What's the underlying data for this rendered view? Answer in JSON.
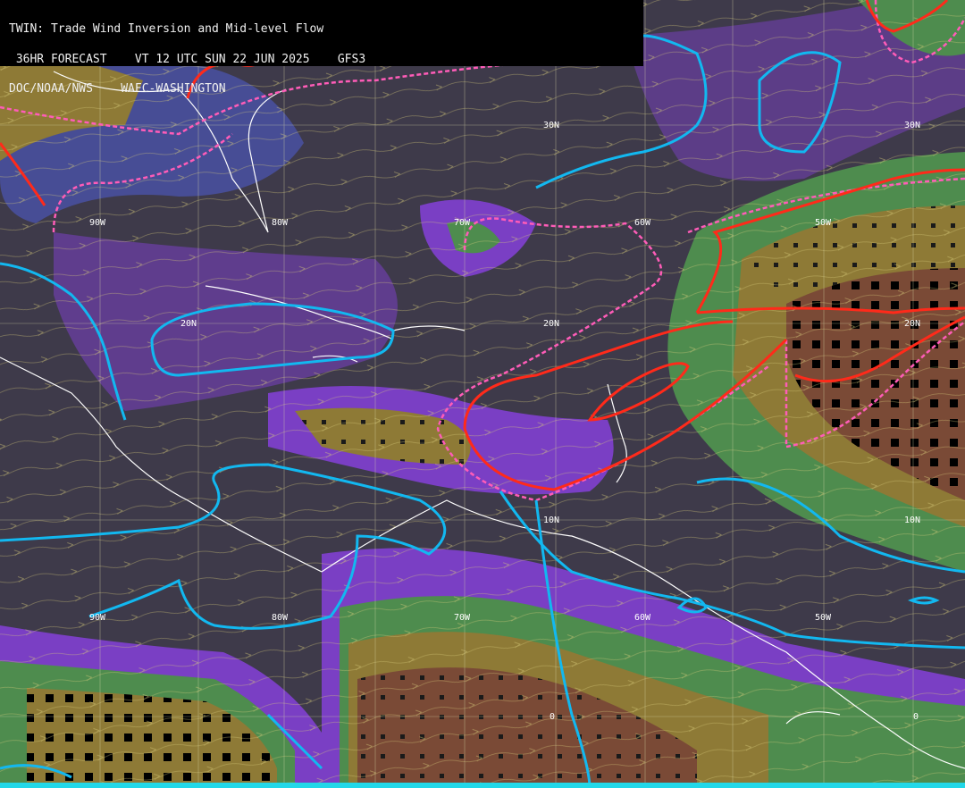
{
  "header": {
    "line1": "TWIN: Trade Wind Inversion and Mid-level Flow",
    "line2": " 36HR FORECAST    VT 12 UTC SUN 22 JUN 2025    GFS3",
    "line3": "DOC/NOAA/NWS    WAFC-WASHINGTON"
  },
  "grid_labels": {
    "lat": [
      "30N",
      "20N",
      "10N",
      "0"
    ],
    "lon": [
      "90W",
      "80W",
      "70W",
      "60W",
      "50W"
    ]
  },
  "colors": {
    "background": "#3e3a4a",
    "purple": "#7a3fc4",
    "blue": "#4a52a8",
    "green": "#4e8c4e",
    "olive": "#8e7a36",
    "brown": "#7a4a36",
    "cyan_contour": "#12b8f0",
    "red_contour": "#ff2a1a",
    "pink_dashed": "#ff5cb8",
    "coast": "#ffffff",
    "streamline": "#d8cc7a",
    "grid": "#d8d8a8"
  }
}
